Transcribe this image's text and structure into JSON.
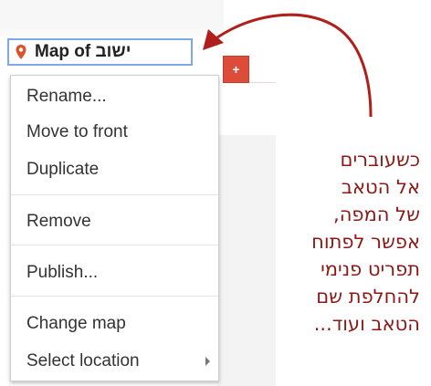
{
  "tab": {
    "title": "Map of ישוב",
    "pin_icon": "map-pin-icon",
    "pin_color": "#d9532c"
  },
  "add_tab": {
    "label": "+",
    "color": "#dd4b39"
  },
  "menu": {
    "groups": [
      [
        "Rename...",
        "Move to front",
        "Duplicate"
      ],
      [
        "Remove"
      ],
      [
        "Publish..."
      ],
      [
        "Change map",
        "Select location"
      ]
    ],
    "submenu_icon": "chevron-right-icon"
  },
  "annotation": {
    "lines": [
      "כשעוברים",
      "אל הטאב",
      "של המפה,",
      "אפשר לפתוח",
      "תפריט פנימי",
      "להחלפת שם",
      "הטאב ועוד..."
    ],
    "color": "#8b1a17",
    "arrow_color": "#b01f1b"
  }
}
